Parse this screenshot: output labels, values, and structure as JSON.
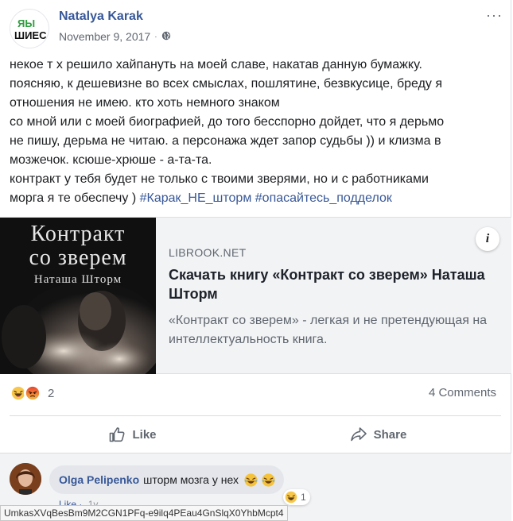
{
  "post": {
    "author": "Natalya Karak",
    "date": "November 9, 2017",
    "privacy_icon": "globe-icon",
    "avatar_text_top": "ЯЫ",
    "avatar_text_bottom": "ШИЕС",
    "lines": [
      "некое т х решило хайпануть на моей славе, накатав данную бумажку.",
      "поясняю, к дешевизне во всех смыслах, пошлятине, безвкусице, бреду я",
      "отношения не имею. кто хоть немного знаком",
      "со мной или с моей биографией, до того бесспорно дойдет, что я дерьмо",
      "не пишу, дерьма не читаю. а персонажа ждет запор судьбы )) и клизма в",
      "мозжечок. ксюше-хрюше - а-та-та.",
      "контракт у тебя будет не только с твоими зверями, но и с работниками"
    ],
    "last_line_text": "морга я те обеспечу ) ",
    "tags": [
      "#Карак_НЕ_шторм",
      "#опасайтесь_подделок"
    ]
  },
  "link": {
    "cover_title_line1": "Контракт",
    "cover_title_line2": "со зверем",
    "cover_author": "Наташа Шторм",
    "domain": "LIBROOK.NET",
    "title": "Скачать книгу «Контракт со зверем» Наташа Шторм",
    "description": "«Контракт со зверем» - легкая и не претендующая на интеллектуальность книга.",
    "info_label": "i"
  },
  "stats": {
    "reaction_icons": [
      "haha-icon",
      "angry-icon"
    ],
    "reaction_count": "2",
    "comments": "4 Comments"
  },
  "actions": {
    "like": "Like",
    "share": "Share"
  },
  "comment": {
    "author": "Olga Pelipenko",
    "text": "шторм мозга у нех",
    "reaction_count": "1",
    "like_label": "Like",
    "time": "1y"
  },
  "status_url": "UmkasXVqBesBm9M2CGN1PFq-e9ilq4PEau4GnSlqX0YhbMcpt4",
  "colors": {
    "link_blue": "#385898",
    "secondary_text": "#606770",
    "card_bg": "#f2f3f5"
  }
}
